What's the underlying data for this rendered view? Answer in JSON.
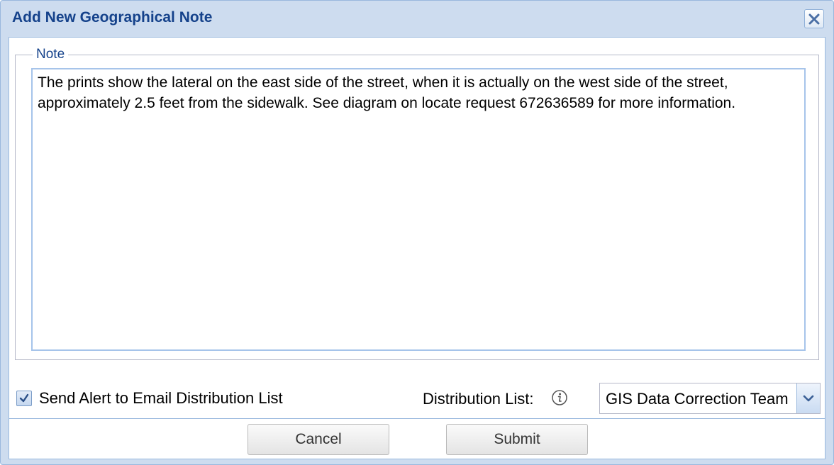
{
  "dialog": {
    "title": "Add New Geographical Note",
    "close_icon": "close-icon"
  },
  "note": {
    "legend": "Note",
    "value": "The prints show the lateral on the east side of the street, when it is actually on the west side of the street, approximately 2.5 feet from the sidewalk. See diagram on locate request 672636589 for more information."
  },
  "alert": {
    "checked": true,
    "label": "Send Alert to Email Distribution List"
  },
  "distribution": {
    "label": "Distribution List:",
    "info_icon": "info-icon",
    "selected": "GIS Data Correction Team"
  },
  "buttons": {
    "cancel": "Cancel",
    "submit": "Submit"
  },
  "colors": {
    "title_text": "#15428b",
    "frame": "#cddcef",
    "frame_border": "#99b8de"
  }
}
